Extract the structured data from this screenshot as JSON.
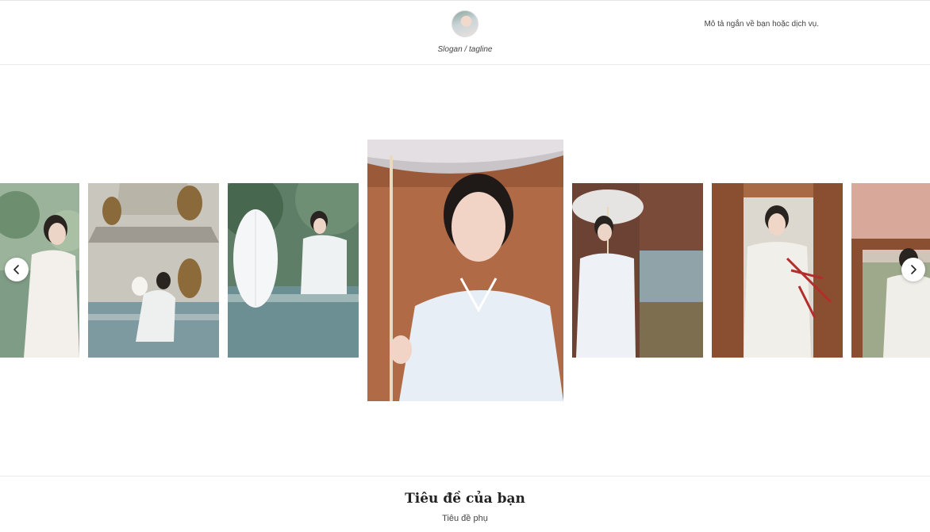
{
  "header": {
    "avatar_alt": "avatar",
    "tagline": "Slogan / tagline",
    "description": "Mô tả ngắn về bạn hoặc dịch vụ."
  },
  "gallery": {
    "previous_icon": "chevron-left-icon",
    "next_icon": "chevron-right-icon"
  },
  "footer": {
    "title": "Tiêu đề của bạn",
    "subtitle": "Tiêu đề phụ"
  }
}
